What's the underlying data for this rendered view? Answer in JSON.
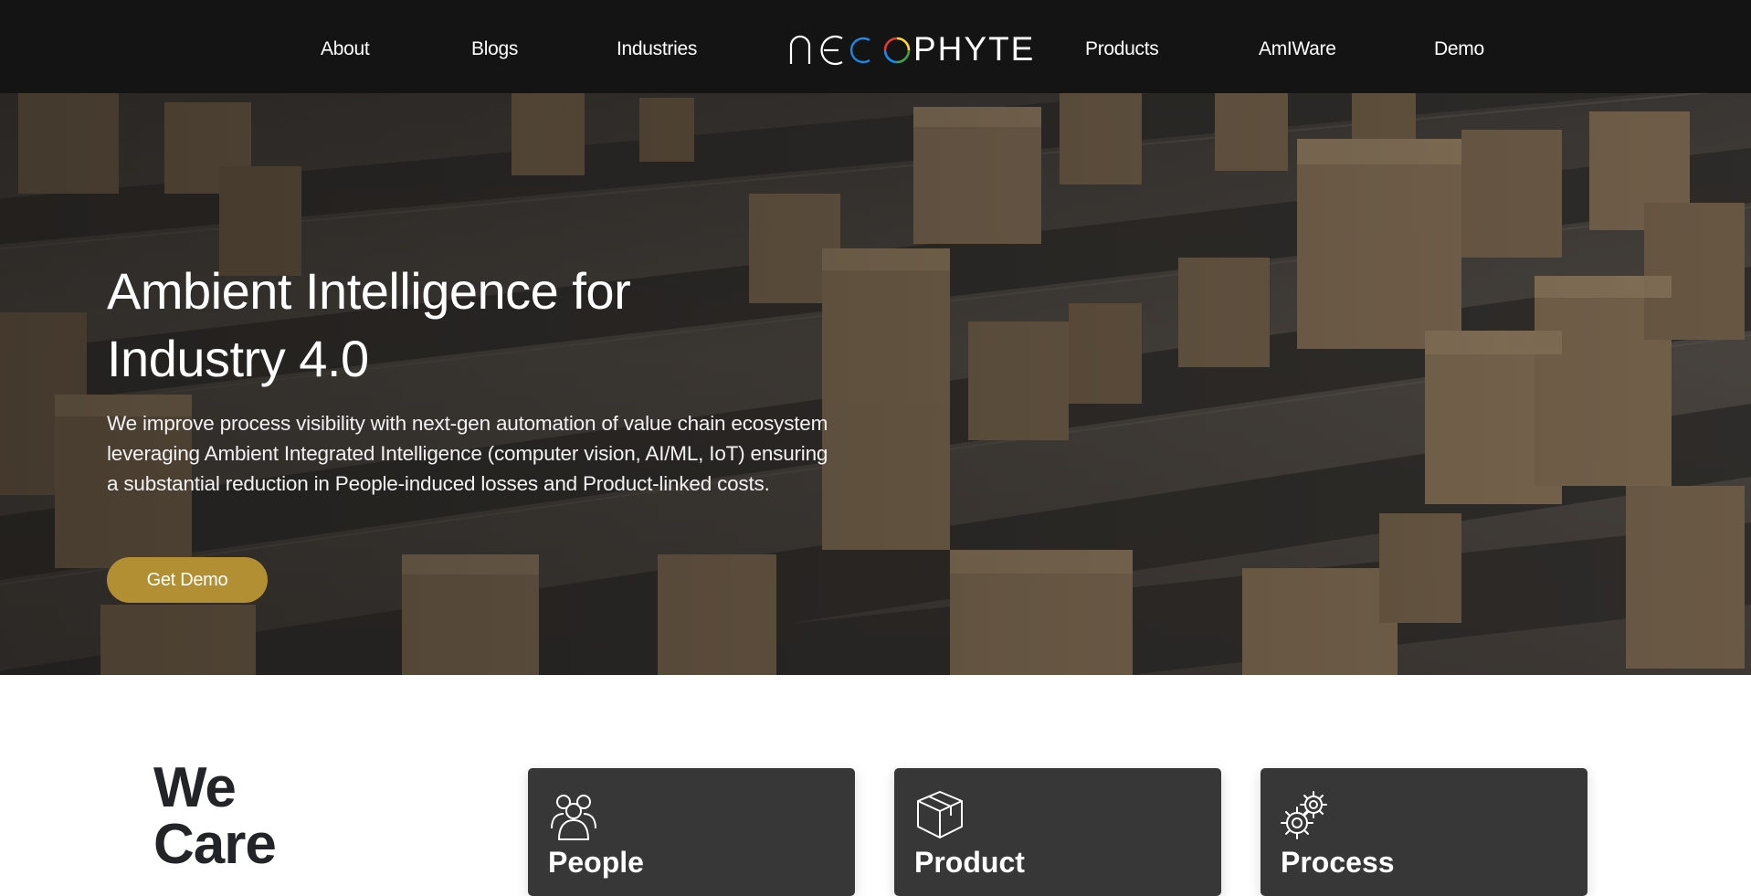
{
  "nav": {
    "left_links": [
      "About",
      "Blogs",
      "Industries"
    ],
    "right_links": [
      "Products",
      "AmIWare",
      "Demo"
    ],
    "logo": {
      "text": "NEOPHYTE",
      "ring_colors": [
        "#e53935",
        "#fdd835",
        "#43a047",
        "#1e88e5"
      ]
    }
  },
  "hero": {
    "title_line1": "Ambient Intelligence for",
    "title_line2": "Industry 4.0",
    "description": "We improve process visibility with next-gen automation of value chain ecosystem leveraging Ambient Integrated Intelligence (computer vision, AI/ML, IoT) ensuring a substantial reduction in People-induced losses and Product-linked costs.",
    "cta_label": "Get Demo",
    "cta_color": "#b38f34"
  },
  "care": {
    "heading_line1": "We",
    "heading_line2": "Care",
    "cards": [
      {
        "title": "People",
        "icon": "people-icon"
      },
      {
        "title": "Product",
        "icon": "box-icon"
      },
      {
        "title": "Process",
        "icon": "gears-icon"
      }
    ]
  }
}
